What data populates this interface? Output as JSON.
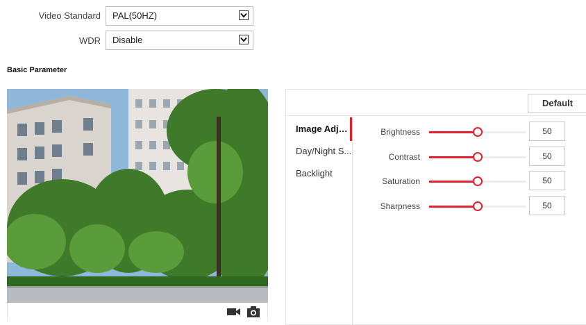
{
  "settings": {
    "video_standard": {
      "label": "Video Standard",
      "value": "PAL(50HZ)"
    },
    "wdr": {
      "label": "WDR",
      "value": "Disable"
    }
  },
  "section_title": "Basic Parameter",
  "video": {
    "record_icon": "video-camera-icon",
    "snapshot_icon": "camera-icon"
  },
  "panel": {
    "default_label": "Default",
    "menu": [
      {
        "label": "Image Adju...",
        "active": true
      },
      {
        "label": "Day/Night S...",
        "active": false
      },
      {
        "label": "Backlight",
        "active": false
      }
    ],
    "sliders": [
      {
        "label": "Brightness",
        "value": 50,
        "min": 0,
        "max": 100
      },
      {
        "label": "Contrast",
        "value": 50,
        "min": 0,
        "max": 100
      },
      {
        "label": "Saturation",
        "value": 50,
        "min": 0,
        "max": 100
      },
      {
        "label": "Sharpness",
        "value": 50,
        "min": 0,
        "max": 100
      }
    ]
  },
  "colors": {
    "accent": "#e0202a"
  }
}
